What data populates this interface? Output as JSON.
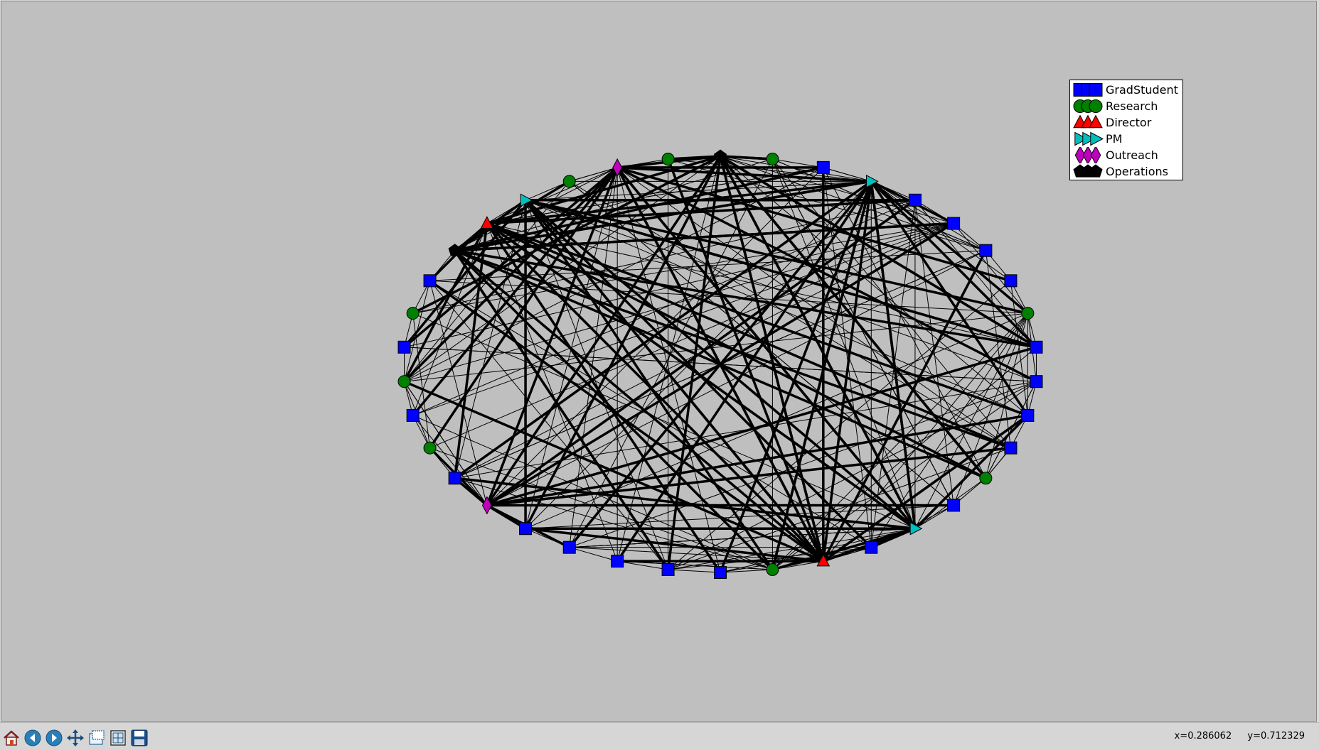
{
  "legend": {
    "items": [
      {
        "label": "GradStudent",
        "shape": "square",
        "color": "#0000ff"
      },
      {
        "label": "Research",
        "shape": "circle",
        "color": "#008000"
      },
      {
        "label": "Director",
        "shape": "triangle-up",
        "color": "#ff0000"
      },
      {
        "label": "PM",
        "shape": "triangle-right",
        "color": "#00bfbf"
      },
      {
        "label": "Outreach",
        "shape": "diamond",
        "color": "#bf00bf"
      },
      {
        "label": "Operations",
        "shape": "pentagon",
        "color": "#000000"
      }
    ]
  },
  "graph": {
    "nodes": [
      {
        "type": "Operations"
      },
      {
        "type": "Research"
      },
      {
        "type": "GradStudent"
      },
      {
        "type": "PM"
      },
      {
        "type": "GradStudent"
      },
      {
        "type": "GradStudent"
      },
      {
        "type": "GradStudent"
      },
      {
        "type": "GradStudent"
      },
      {
        "type": "Research"
      },
      {
        "type": "GradStudent"
      },
      {
        "type": "GradStudent"
      },
      {
        "type": "GradStudent"
      },
      {
        "type": "GradStudent"
      },
      {
        "type": "Research"
      },
      {
        "type": "GradStudent"
      },
      {
        "type": "PM"
      },
      {
        "type": "GradStudent"
      },
      {
        "type": "Director"
      },
      {
        "type": "Research"
      },
      {
        "type": "GradStudent"
      },
      {
        "type": "GradStudent"
      },
      {
        "type": "GradStudent"
      },
      {
        "type": "GradStudent"
      },
      {
        "type": "GradStudent"
      },
      {
        "type": "Outreach"
      },
      {
        "type": "GradStudent"
      },
      {
        "type": "Research"
      },
      {
        "type": "GradStudent"
      },
      {
        "type": "Research"
      },
      {
        "type": "GradStudent"
      },
      {
        "type": "Research"
      },
      {
        "type": "GradStudent"
      },
      {
        "type": "Operations"
      },
      {
        "type": "Director"
      },
      {
        "type": "PM"
      },
      {
        "type": "Research"
      },
      {
        "type": "Outreach"
      },
      {
        "type": "Research"
      }
    ]
  },
  "toolbar": {
    "buttons": [
      {
        "name": "home-button",
        "icon": "home-icon"
      },
      {
        "name": "back-button",
        "icon": "back-arrow-icon"
      },
      {
        "name": "forward-button",
        "icon": "forward-arrow-icon"
      },
      {
        "name": "pan-button",
        "icon": "pan-move-icon"
      },
      {
        "name": "zoom-button",
        "icon": "zoom-rect-icon"
      },
      {
        "name": "configure-subplots-button",
        "icon": "subplots-icon"
      },
      {
        "name": "save-button",
        "icon": "save-disk-icon"
      }
    ]
  },
  "status": {
    "x_readout": "x=0.286062",
    "y_readout": "y=0.712329"
  }
}
